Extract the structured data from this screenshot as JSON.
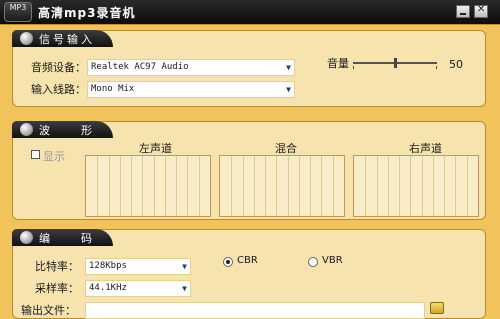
{
  "window": {
    "title": "高清mp3录音机",
    "icon_text": "MP3"
  },
  "signal_input": {
    "title": "信号输入",
    "device_label": "音频设备：",
    "device_value": "Realtek AC97 Audio",
    "line_label": "输入线路：",
    "line_value": "Mono Mix",
    "volume_label": "音量",
    "volume_value": "50",
    "volume_level": 0.5
  },
  "waveform": {
    "title": "波　　形",
    "show_label": "显示",
    "left_label": "左声道",
    "mix_label": "混合",
    "right_label": "右声道"
  },
  "encode": {
    "title": "编　　码",
    "bitrate_label": "比特率：",
    "bitrate_value": "128Kbps",
    "samplerate_label": "采样率：",
    "samplerate_value": "44.1KHz",
    "cbr_label": "CBR",
    "vbr_label": "VBR",
    "output_label": "输出文件："
  }
}
